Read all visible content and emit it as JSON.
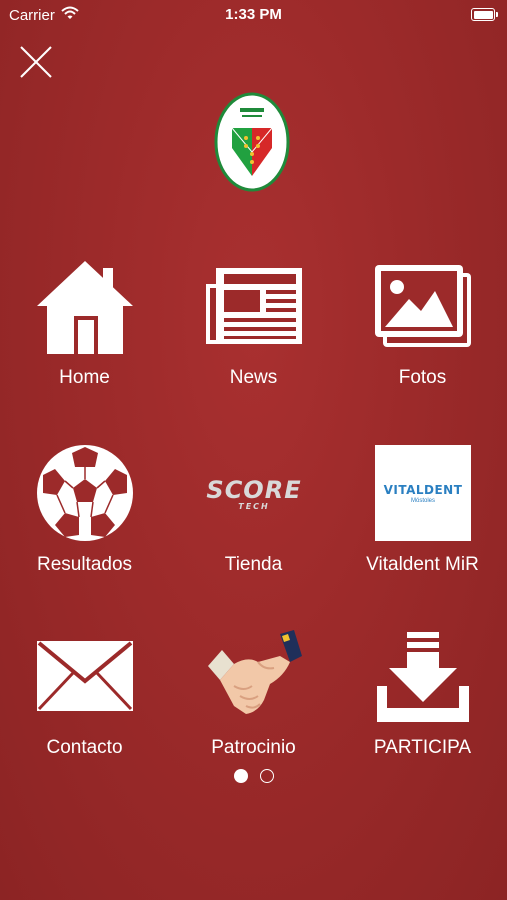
{
  "status_bar": {
    "carrier": "Carrier",
    "time": "1:33 PM"
  },
  "logo": {
    "colors": {
      "border": "#1f8a3a",
      "red": "#d62828",
      "green": "#21a140",
      "dots": "#f2c230"
    }
  },
  "menu": {
    "items": [
      {
        "label": "Home",
        "icon": "home-icon"
      },
      {
        "label": "News",
        "icon": "newspaper-icon"
      },
      {
        "label": "Fotos",
        "icon": "photos-icon"
      },
      {
        "label": "Resultados",
        "icon": "soccer-ball-icon"
      },
      {
        "label": "Tienda",
        "icon": "score-tech-logo"
      },
      {
        "label": "Vitaldent MiR",
        "icon": "vitaldent-logo"
      },
      {
        "label": "Contacto",
        "icon": "envelope-icon"
      },
      {
        "label": "Patrocinio",
        "icon": "handshake-icon"
      },
      {
        "label": "PARTICIPA",
        "icon": "download-tray-icon"
      }
    ]
  },
  "tienda_logo": {
    "main": "SCORE",
    "sub": "TECH"
  },
  "vitaldent_logo": {
    "main": "VITALDENT",
    "sub": "Móstoles"
  },
  "pager": {
    "page_count": 2,
    "current_page": 1
  },
  "colors": {
    "background": "#9c2a2a",
    "text": "#ffffff"
  }
}
